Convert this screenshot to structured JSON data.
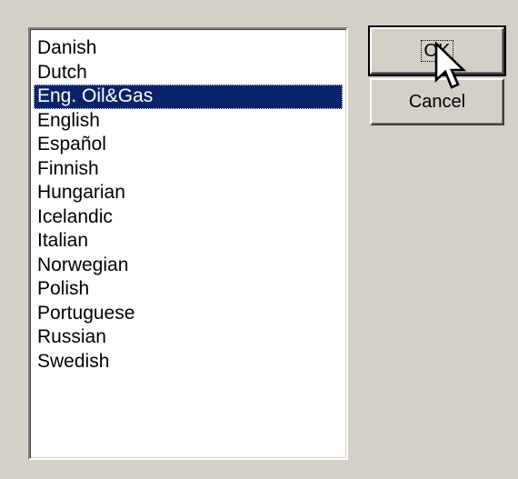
{
  "dialog": {
    "language_list": {
      "items": [
        "Danish",
        "Dutch",
        "Eng. Oil&Gas",
        "English",
        "Español",
        "Finnish",
        "Hungarian",
        "Icelandic",
        "Italian",
        "Norwegian",
        "Polish",
        "Portuguese",
        "Russian",
        "Swedish"
      ],
      "selected_index": 2
    },
    "buttons": {
      "ok_label": "OK",
      "cancel_label": "Cancel"
    },
    "colors": {
      "background": "#d4d0c8",
      "selection": "#0a246a"
    },
    "cursor_icon": "arrow-pointer-icon"
  }
}
